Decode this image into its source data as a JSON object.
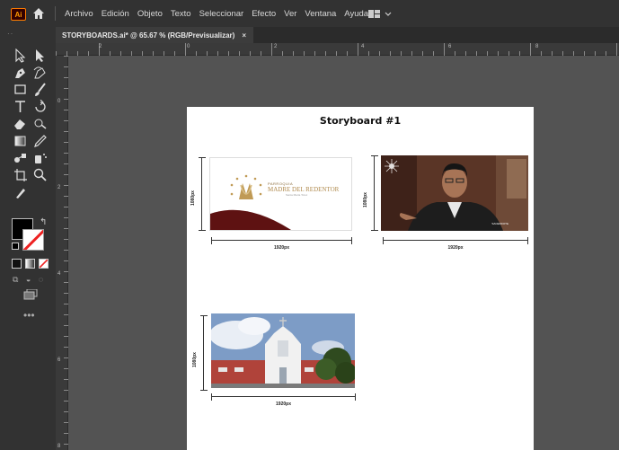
{
  "app": {
    "logo_text": "Ai",
    "menus": [
      "Archivo",
      "Edición",
      "Objeto",
      "Texto",
      "Seleccionar",
      "Efecto",
      "Ver",
      "Ventana",
      "Ayuda"
    ],
    "accent_color": "#ff9a00"
  },
  "panel": {
    "grip": "··",
    "draw_modes": "⧉ ◒ ◌",
    "more_tools": "•••",
    "tools": [
      "selection-tool",
      "direct-selection-tool",
      "pen-tool",
      "curvature-tool",
      "rectangle-tool",
      "paintbrush-tool",
      "type-tool",
      "rotate-tool",
      "eraser-tool",
      "shape-builder-tool",
      "gradient-tool",
      "eyedropper-tool",
      "blend-tool",
      "symbol-sprayer-tool",
      "artboard-tool",
      "zoom-tool",
      "hand-tool"
    ],
    "fill_color": "#000000",
    "stroke_color": "#ffffff"
  },
  "tab": {
    "title": "STORYBOARDS.ai* @ 65.67 % (RGB/Previsualizar)",
    "close": "×"
  },
  "rulers": {
    "top": [
      "2",
      "0",
      "2",
      "4",
      "6",
      "8"
    ],
    "left": [
      "0",
      "2",
      "4",
      "6",
      "8"
    ]
  },
  "artboard": {
    "title": "Storyboard #1",
    "frames": [
      {
        "width_label": "1920px",
        "height_label": "1080px",
        "content": {
          "small": "PARROQUIA",
          "big": "MADRE DEL REDENTOR",
          "tiny": "Santa María Totoc"
        }
      },
      {
        "width_label": "1920px",
        "height_label": "1080px",
        "caption": "SACERDOTE"
      },
      {
        "width_label": "1920px",
        "height_label": "1080px"
      }
    ]
  }
}
